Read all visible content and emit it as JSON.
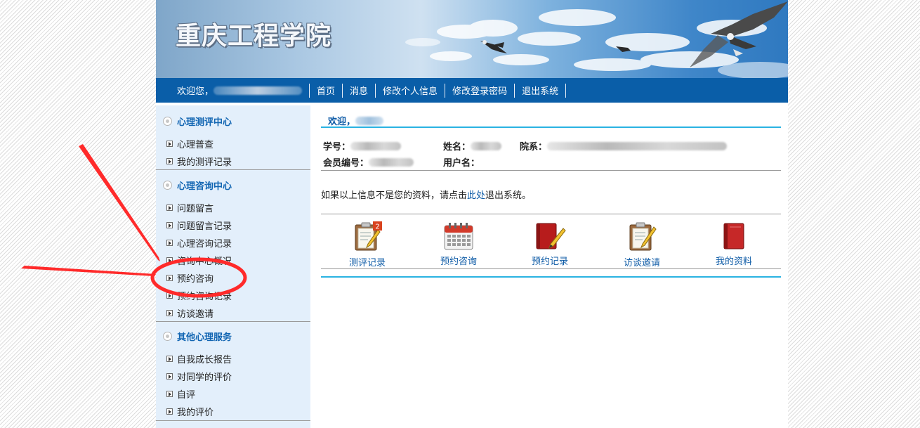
{
  "header": {
    "site_title": "重庆工程学院"
  },
  "nav": {
    "welcome": "欢迎您，",
    "items": [
      "首页",
      "消息",
      "修改个人信息",
      "修改登录密码",
      "退出系统"
    ]
  },
  "sidebar": {
    "sections": [
      {
        "title": "心理测评中心",
        "items": [
          "心理普查",
          "我的测评记录"
        ]
      },
      {
        "title": "心理咨询中心",
        "items": [
          "问题留言",
          "问题留言记录",
          "心理咨询记录",
          "咨询中心概况",
          "预约咨询",
          "预约咨询记录",
          "访谈邀请"
        ]
      },
      {
        "title": "其他心理服务",
        "items": [
          "自我成长报告",
          "对同学的评价",
          "自评",
          "我的评价"
        ]
      }
    ]
  },
  "main": {
    "welcome": "欢迎，",
    "fields": {
      "student_no": "学号：",
      "name": "姓名：",
      "department": "院系：",
      "member_no": "会员编号：",
      "username": "用户名："
    },
    "note_prefix": "如果以上信息不是您的资料，请点击",
    "note_link": "此处",
    "note_suffix": "退出系统。",
    "shortcuts": [
      {
        "label": "测评记录",
        "icon": "clipboard-pencil-icon",
        "badge": "2"
      },
      {
        "label": "预约咨询",
        "icon": "calendar-icon"
      },
      {
        "label": "预约记录",
        "icon": "red-notebook-pencil-icon"
      },
      {
        "label": "访谈邀请",
        "icon": "clipboard-pencil-icon"
      },
      {
        "label": "我的资料",
        "icon": "red-book-icon"
      }
    ]
  },
  "colors": {
    "nav_bg": "#0a5ea8",
    "sidebar_bg": "#e3effb",
    "link": "#0c5aa6",
    "accent_line": "#2ab3e2",
    "annotation": "#ff2a2a"
  }
}
